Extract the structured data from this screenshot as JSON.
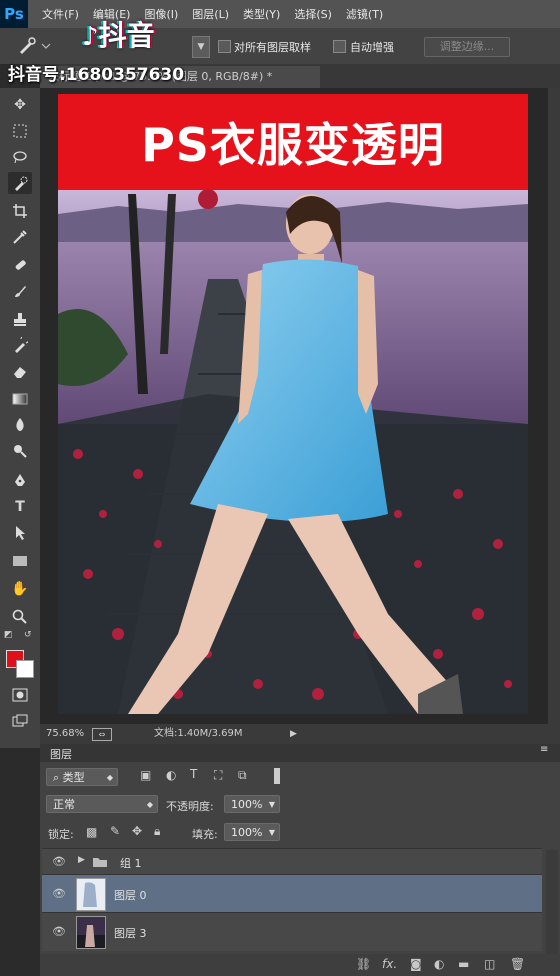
{
  "app": {
    "logo": "Ps"
  },
  "menu": [
    "文件(F)",
    "编辑(E)",
    "图像(I)",
    "图层(L)",
    "类型(Y)",
    "选择(S)",
    "滤镜(T)"
  ],
  "options": {
    "tool_icon": "quick-selection-brush-icon",
    "sample_all_layers": "对所有图层取样",
    "auto_enhance": "自动增强",
    "refine_edge": "调整边缘..."
  },
  "watermark": {
    "logo": "抖音",
    "id": "抖音号:1680357630"
  },
  "document": {
    "tab_title": "未标题-1.psd @ 75.7% (图层 0, RGB/8#) *"
  },
  "canvas": {
    "banner_text": "PS衣服变透明"
  },
  "status": {
    "zoom": "75.68%",
    "doc_size": "文档:1.40M/3.69M"
  },
  "layers_panel": {
    "title": "图层",
    "filter_label": "类型",
    "blend_mode": "正常",
    "opacity_label": "不透明度:",
    "opacity_value": "100%",
    "lock_label": "锁定:",
    "fill_label": "填充:",
    "fill_value": "100%",
    "layers": [
      {
        "name": "组 1",
        "type": "group"
      },
      {
        "name": "图层 0",
        "type": "layer",
        "selected": true
      },
      {
        "name": "图层 3",
        "type": "layer"
      }
    ]
  },
  "colors": {
    "accent": "#e6121b",
    "foreground": "#e0101a",
    "selection": "#5f6f86"
  }
}
